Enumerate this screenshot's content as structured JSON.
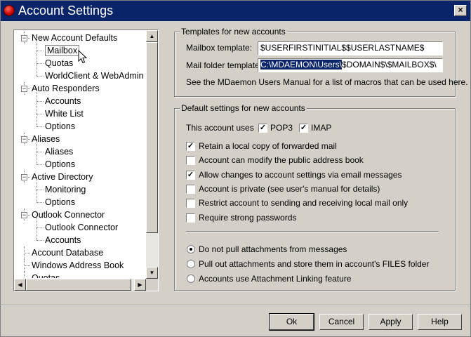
{
  "window": {
    "title": "Account Settings",
    "close_glyph": "×"
  },
  "tree": {
    "items": [
      {
        "label": "New Account Defaults",
        "level": 0,
        "expander": "−"
      },
      {
        "label": "Mailbox",
        "level": 1,
        "selected": true
      },
      {
        "label": "Quotas",
        "level": 1
      },
      {
        "label": "WorldClient & WebAdmin",
        "level": 1
      },
      {
        "label": "Auto Responders",
        "level": 0,
        "expander": "−"
      },
      {
        "label": "Accounts",
        "level": 1
      },
      {
        "label": "White List",
        "level": 1
      },
      {
        "label": "Options",
        "level": 1
      },
      {
        "label": "Aliases",
        "level": 0,
        "expander": "−"
      },
      {
        "label": "Aliases",
        "level": 1
      },
      {
        "label": "Options",
        "level": 1
      },
      {
        "label": "Active Directory",
        "level": 0,
        "expander": "−"
      },
      {
        "label": "Monitoring",
        "level": 1
      },
      {
        "label": "Options",
        "level": 1
      },
      {
        "label": "Outlook Connector",
        "level": 0,
        "expander": "−"
      },
      {
        "label": "Outlook Connector",
        "level": 1
      },
      {
        "label": "Accounts",
        "level": 1
      },
      {
        "label": "Account Database",
        "level": 0
      },
      {
        "label": "Windows Address Book",
        "level": 0
      },
      {
        "label": "Quotas",
        "level": 0
      }
    ]
  },
  "templates": {
    "group_label": "Templates for new accounts",
    "mailbox_label": "Mailbox template:",
    "mailbox_value": "$USERFIRSTINITIAL$$USERLASTNAME$",
    "folder_label": "Mail folder template:",
    "folder_value_selected": "C:\\MDAEMON\\Users\\",
    "folder_value_rest": "$DOMAIN$\\$MAILBOX$\\",
    "note": "See the MDaemon Users Manual for a list of macros that can be used here."
  },
  "defaults": {
    "group_label": "Default settings for new accounts",
    "uses_label": "This account uses",
    "pop3_label": "POP3",
    "imap_label": "IMAP",
    "checks": [
      {
        "label": "Retain a local copy of forwarded mail",
        "checked": true
      },
      {
        "label": "Account can modify the public address book",
        "checked": false
      },
      {
        "label": "Allow changes to account settings via email messages",
        "checked": true
      },
      {
        "label": "Account is private (see user's manual for details)",
        "checked": false
      },
      {
        "label": "Restrict account to sending and receiving local mail only",
        "checked": false
      },
      {
        "label": "Require strong passwords",
        "checked": false
      }
    ],
    "radios": [
      {
        "label": "Do not pull attachments from messages",
        "selected": true
      },
      {
        "label": "Pull out attachments and store them in account's FILES folder",
        "selected": false
      },
      {
        "label": "Accounts use Attachment Linking feature",
        "selected": false
      }
    ]
  },
  "buttons": {
    "ok": "Ok",
    "cancel": "Cancel",
    "apply": "Apply",
    "help": "Help"
  }
}
